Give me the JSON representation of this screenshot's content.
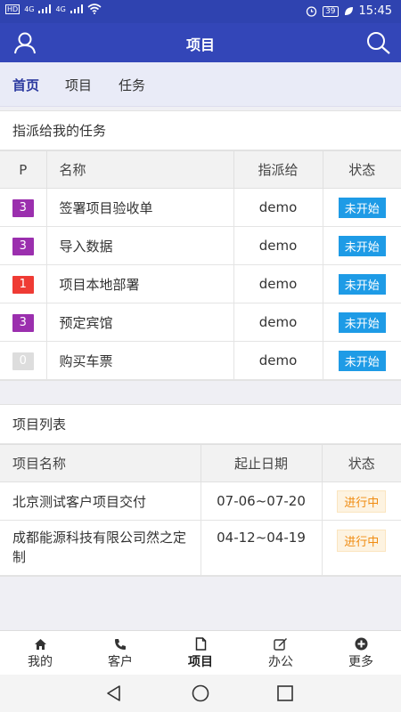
{
  "status_bar": {
    "network_labels": [
      "HD",
      "4G",
      "4G"
    ],
    "time": "15:45",
    "battery": "39",
    "icons": [
      "alarm-icon",
      "battery-icon",
      "leaf-icon",
      "wifi-icon"
    ]
  },
  "app_bar": {
    "title": "项目",
    "left_icon": "user-icon",
    "right_icon": "search-icon"
  },
  "tabs": [
    {
      "label": "首页",
      "active": true
    },
    {
      "label": "项目",
      "active": false
    },
    {
      "label": "任务",
      "active": false
    }
  ],
  "tasks_card": {
    "title": "指派给我的任务",
    "columns": [
      "P",
      "名称",
      "指派给",
      "状态"
    ],
    "rows": [
      {
        "priority": "3",
        "priority_color": "#9b2fae",
        "name": "签署项目验收单",
        "assignee": "demo",
        "status": "未开始"
      },
      {
        "priority": "3",
        "priority_color": "#9b2fae",
        "name": "导入数据",
        "assignee": "demo",
        "status": "未开始"
      },
      {
        "priority": "1",
        "priority_color": "#ef3b34",
        "name": "项目本地部署",
        "assignee": "demo",
        "status": "未开始"
      },
      {
        "priority": "3",
        "priority_color": "#9b2fae",
        "name": "预定宾馆",
        "assignee": "demo",
        "status": "未开始"
      },
      {
        "priority": "0",
        "priority_color": "#dddddd",
        "name": "购买车票",
        "assignee": "demo",
        "status": "未开始"
      }
    ]
  },
  "projects_card": {
    "title": "项目列表",
    "columns": [
      "项目名称",
      "起止日期",
      "状态"
    ],
    "rows": [
      {
        "name": "北京测试客户项目交付",
        "dates": "07-06~07-20",
        "status": "进行中"
      },
      {
        "name": "成都能源科技有限公司然之定制",
        "dates": "04-12~04-19",
        "status": "进行中"
      }
    ]
  },
  "bottom_nav": [
    {
      "label": "我的",
      "icon": "home-icon",
      "active": false
    },
    {
      "label": "客户",
      "icon": "phone-icon",
      "active": false
    },
    {
      "label": "项目",
      "icon": "document-icon",
      "active": true
    },
    {
      "label": "办公",
      "icon": "edit-icon",
      "active": false
    },
    {
      "label": "更多",
      "icon": "plus-circle-icon",
      "active": false
    }
  ],
  "system_nav": [
    "back-icon",
    "home-circle-icon",
    "recents-icon"
  ],
  "colors": {
    "primary": "#3346b8",
    "status_blue": "#1e9be6",
    "status_orange": "#f08b10"
  }
}
